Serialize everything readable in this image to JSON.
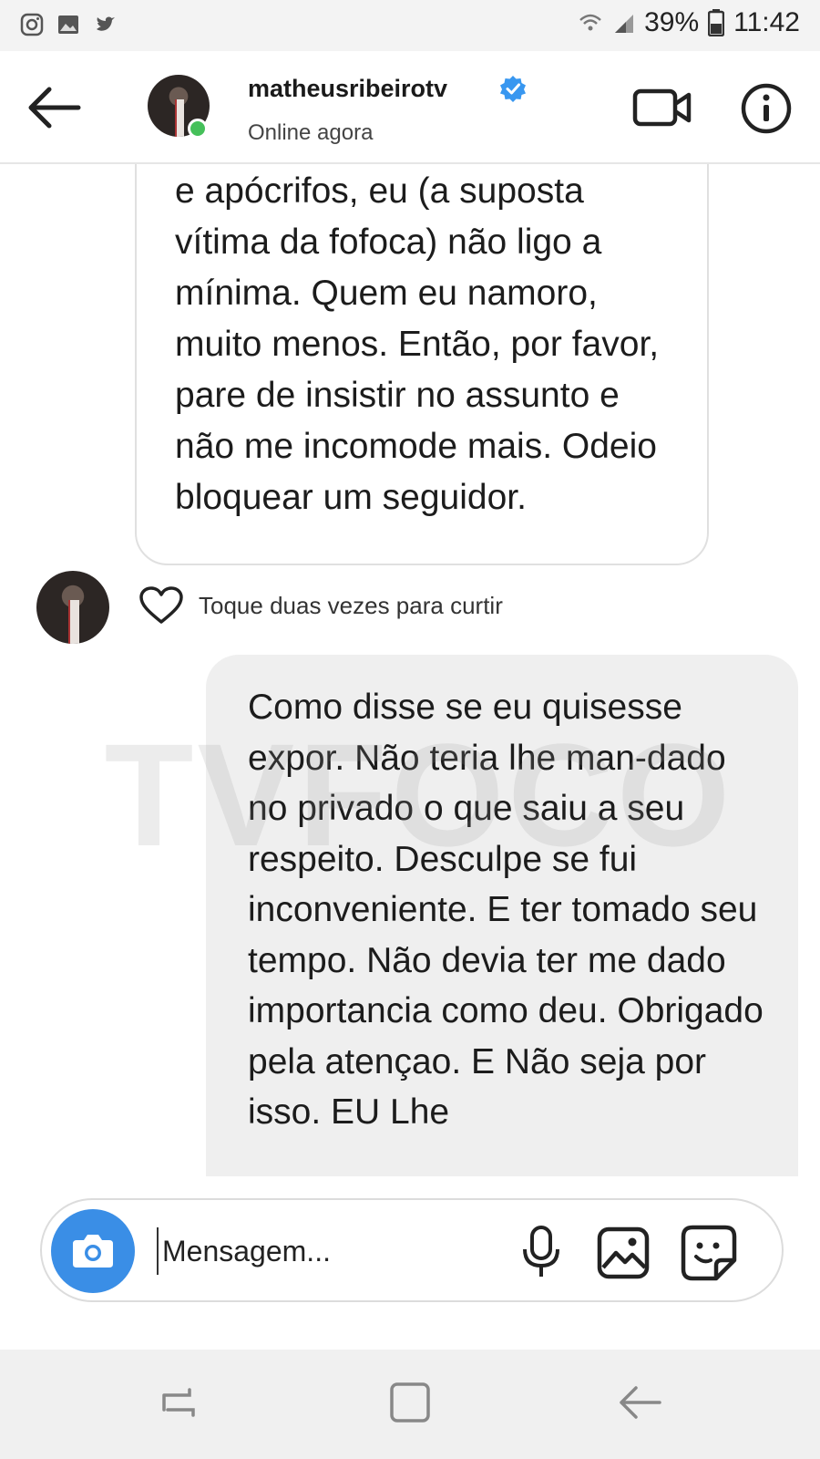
{
  "status_bar": {
    "battery": "39%",
    "time": "11:42",
    "icons": [
      "instagram-icon",
      "gallery-icon",
      "twitter-icon",
      "wifi-icon",
      "signal-icon",
      "battery-icon"
    ]
  },
  "header": {
    "username": "matheusribeirotv",
    "status": "Online agora",
    "icons": [
      "back-arrow-icon",
      "verified-badge-icon",
      "video-call-icon",
      "info-icon"
    ]
  },
  "messages": {
    "received_text": "e apócrifos, eu (a suposta vítima da fofoca) não ligo a mínima. Quem eu namoro, muito menos. Então, por favor, pare de insistir no assunto e não me incomode mais. Odeio bloquear um seguidor.",
    "like_hint": "Toque duas vezes para curtir",
    "sent_text": "Como disse se eu quisesse expor. Não teria lhe man-dado no privado o que saiu a seu respeito. Desculpe se fui inconveniente. E ter tomado seu tempo. Não devia ter me dado importancia como deu. Obrigado pela atençao. E Não seja por isso. EU Lhe"
  },
  "watermark": "TVFOCO",
  "composer": {
    "placeholder": "Mensagem...",
    "icons": [
      "camera-icon",
      "microphone-icon",
      "gallery-icon",
      "sticker-icon"
    ]
  },
  "colors": {
    "online": "#45c05a",
    "camera_button": "#3a8ee6",
    "verified": "#3897f0",
    "sent_bubble": "#efefef"
  }
}
